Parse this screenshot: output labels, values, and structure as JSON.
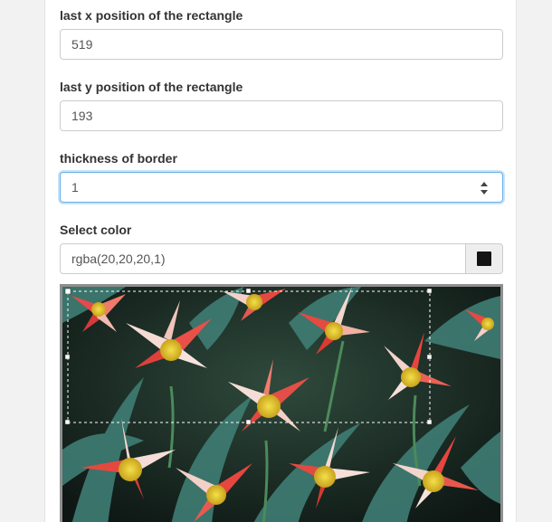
{
  "form": {
    "x_label": "last x position of the rectangle",
    "x_value": "519",
    "y_label": "last y position of the rectangle",
    "y_value": "193",
    "thickness_label": "thickness of border",
    "thickness_value": "1",
    "color_label": "Select color",
    "color_value": "rgba(20,20,20,1)"
  },
  "colors": {
    "swatch": "#141414",
    "focus_border": "#66afe9",
    "selection_stroke": "#ffffff"
  },
  "icons": {
    "spinner": "up-down-arrows-icon"
  }
}
